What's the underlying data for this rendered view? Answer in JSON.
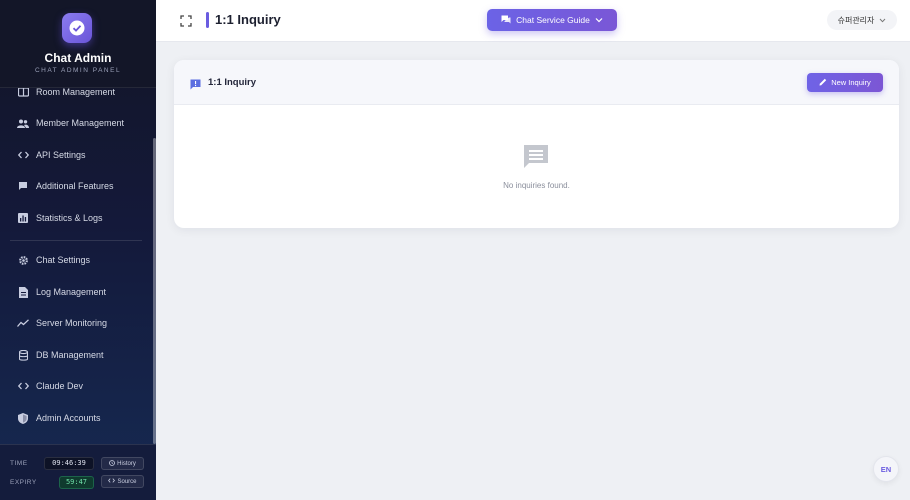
{
  "brand": {
    "title": "Chat Admin",
    "subtitle": "CHAT ADMIN PANEL"
  },
  "sidebar": {
    "items": [
      {
        "label": "Room Management",
        "icon": "room-icon"
      },
      {
        "label": "Member Management",
        "icon": "people-icon"
      },
      {
        "label": "API Settings",
        "icon": "code-icon"
      },
      {
        "label": "Additional Features",
        "icon": "chat-bubble-icon"
      },
      {
        "label": "Statistics & Logs",
        "icon": "bar-chart-icon"
      },
      {
        "label": "Chat Settings",
        "icon": "gear-icon"
      },
      {
        "label": "Log Management",
        "icon": "document-icon"
      },
      {
        "label": "Server Monitoring",
        "icon": "line-chart-icon"
      },
      {
        "label": "DB Management",
        "icon": "database-icon"
      },
      {
        "label": "Claude Dev",
        "icon": "code-icon"
      },
      {
        "label": "Admin Accounts",
        "icon": "shield-icon"
      }
    ]
  },
  "footer": {
    "time_label": "TIME",
    "time_value": "09:46:39",
    "expiry_label": "EXPIRY",
    "expiry_value": "59:47",
    "history_label": "History",
    "source_label": "Source"
  },
  "header": {
    "title": "1:1 Inquiry",
    "guide_label": "Chat Service Guide",
    "user_label": "슈퍼관리자"
  },
  "main": {
    "card_title": "1:1 Inquiry",
    "new_button_label": "New Inquiry",
    "empty_text": "No inquiries found."
  },
  "language": "EN",
  "colors": {
    "accent": "#6a5ce0",
    "sidebar_bg": "#14193a",
    "expiry_green": "#6fe0a8"
  }
}
